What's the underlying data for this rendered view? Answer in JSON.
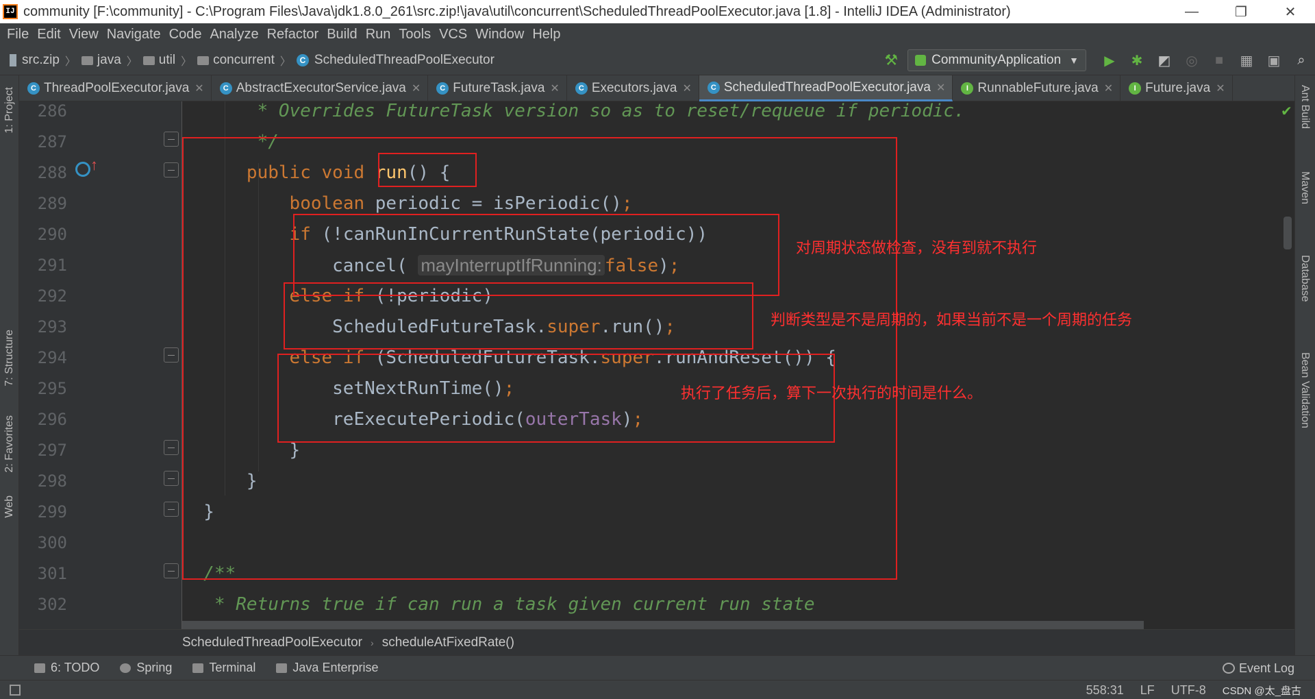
{
  "window": {
    "title": "community [F:\\community] - C:\\Program Files\\Java\\jdk1.8.0_261\\src.zip!\\java\\util\\concurrent\\ScheduledThreadPoolExecutor.java [1.8] - IntelliJ IDEA (Administrator)",
    "minimize": "—",
    "restore": "❐",
    "close": "✕"
  },
  "menu": [
    "File",
    "Edit",
    "View",
    "Navigate",
    "Code",
    "Analyze",
    "Refactor",
    "Build",
    "Run",
    "Tools",
    "VCS",
    "Window",
    "Help"
  ],
  "navbar": {
    "crumbs": [
      "src.zip",
      "java",
      "util",
      "concurrent",
      "ScheduledThreadPoolExecutor"
    ],
    "run_config": "CommunityApplication"
  },
  "tabs": [
    {
      "label": "ThreadPoolExecutor.java",
      "icon": "C",
      "active": false
    },
    {
      "label": "AbstractExecutorService.java",
      "icon": "C",
      "active": false
    },
    {
      "label": "FutureTask.java",
      "icon": "C",
      "active": false
    },
    {
      "label": "Executors.java",
      "icon": "C",
      "active": false
    },
    {
      "label": "ScheduledThreadPoolExecutor.java",
      "icon": "C",
      "active": true
    },
    {
      "label": "RunnableFuture.java",
      "icon": "I",
      "active": false
    },
    {
      "label": "Future.java",
      "icon": "I",
      "active": false
    }
  ],
  "left_tools": [
    "1: Project",
    "7: Structure",
    "2: Favorites",
    "Web"
  ],
  "right_tools": [
    "Ant Build",
    "Maven",
    "Database",
    "Bean Validation"
  ],
  "editor": {
    "line_numbers": [
      "286",
      "287",
      "288",
      "289",
      "290",
      "291",
      "292",
      "293",
      "294",
      "295",
      "296",
      "297",
      "298",
      "299",
      "300",
      "301",
      "302"
    ],
    "param_hint": "mayInterruptIfRunning:"
  },
  "annotations": [
    "对周期状态做检查，没有到就不执行",
    "判断类型是不是周期的，如果当前不是一个周期的任务",
    "执行了任务后，算下一次执行的时间是什么。"
  ],
  "editor_breadcrumb": [
    "ScheduledThreadPoolExecutor",
    "scheduleAtFixedRate()"
  ],
  "tool_windows": [
    "6: TODO",
    "Spring",
    "Terminal",
    "Java Enterprise"
  ],
  "event_log": "Event Log",
  "status": {
    "position": "558:31",
    "line_sep": "LF",
    "encoding": "UTF-8",
    "watermark": "CSDN @太_盘古"
  },
  "colors": {
    "keyword": "#cc7832",
    "method": "#ffc66d",
    "comment": "#629755",
    "field": "#9876aa",
    "annotation_red": "#e02020"
  }
}
